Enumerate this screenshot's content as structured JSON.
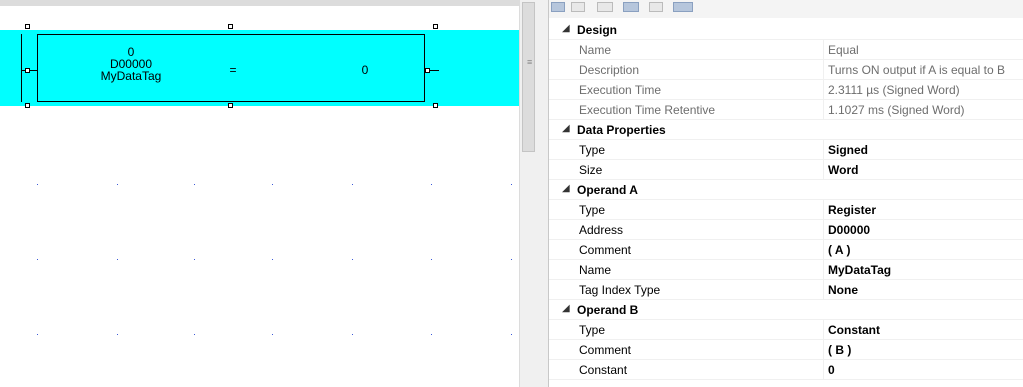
{
  "ladder": {
    "instruction": {
      "top_value": "0",
      "operand_a": "D00000",
      "tag_name": "MyDataTag",
      "operator": "=",
      "operand_b": "0"
    }
  },
  "properties": {
    "categories": [
      {
        "name": "Design",
        "rows": [
          {
            "label": "Name",
            "value": "Equal",
            "readonly": true
          },
          {
            "label": "Description",
            "value": "Turns ON output if A is equal to B",
            "readonly": true
          },
          {
            "label": "Execution Time",
            "value": "2.3111 µs (Signed Word)",
            "readonly": true
          },
          {
            "label": "Execution Time Retentive",
            "value": "1.1027 ms (Signed Word)",
            "readonly": true
          }
        ]
      },
      {
        "name": "Data Properties",
        "rows": [
          {
            "label": "Type",
            "value": "Signed"
          },
          {
            "label": "Size",
            "value": "Word"
          }
        ]
      },
      {
        "name": "Operand A",
        "rows": [
          {
            "label": "Type",
            "value": "Register"
          },
          {
            "label": "Address",
            "value": "D00000"
          },
          {
            "label": "Comment",
            "value": "( A )"
          },
          {
            "label": "Name",
            "value": "MyDataTag"
          },
          {
            "label": "Tag Index Type",
            "value": "None"
          }
        ]
      },
      {
        "name": "Operand B",
        "rows": [
          {
            "label": "Type",
            "value": "Constant"
          },
          {
            "label": "Comment",
            "value": "( B )"
          },
          {
            "label": "Constant",
            "value": "0"
          }
        ]
      }
    ],
    "collapse_icon": "expanded-triangle-icon"
  },
  "colors": {
    "rung_highlight": "#00ffff",
    "grid_dots": "#3a58d8",
    "readonly_text": "#6d6d6d"
  }
}
